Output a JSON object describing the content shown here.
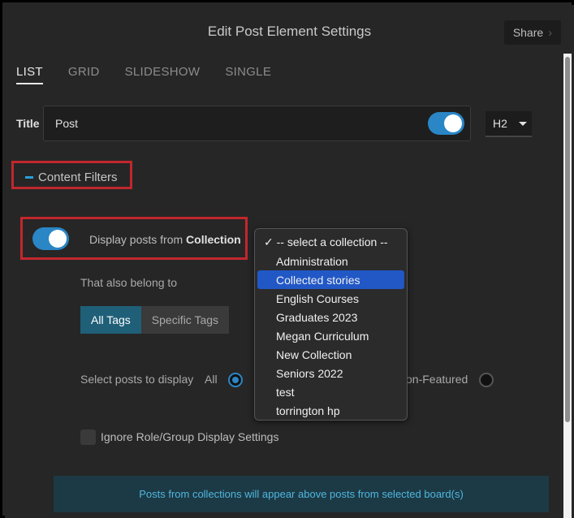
{
  "header": {
    "title": "Edit Post Element Settings",
    "share_label": "Share"
  },
  "tabs": [
    {
      "label": "LIST",
      "active": true
    },
    {
      "label": "GRID",
      "active": false
    },
    {
      "label": "SLIDESHOW",
      "active": false
    },
    {
      "label": "SINGLE",
      "active": false
    }
  ],
  "title_row": {
    "label": "Title",
    "value": "Post",
    "toggle_on": true,
    "heading_level": "H2"
  },
  "content_filters": {
    "label": "Content Filters"
  },
  "collection_row": {
    "label_prefix": "Display posts from ",
    "label_bold": "Collection",
    "toggle_on": true
  },
  "belong_label": "That also belong to",
  "tag_buttons": {
    "all": "All Tags",
    "specific": "Specific Tags"
  },
  "select_posts": {
    "label": "Select posts to display",
    "all_label": "All",
    "nonfeatured_label": "on-Featured"
  },
  "ignore_label": "Ignore Role/Group Display Settings",
  "info_text": "Posts from collections will appear above posts from selected board(s)",
  "dropdown": {
    "items": [
      "✓ -- select a collection --",
      "Administration",
      "Collected stories",
      "English Courses",
      "Graduates 2023",
      "Megan Curriculum",
      "New Collection",
      "Seniors 2022",
      "test",
      "torrington hp"
    ],
    "highlighted": "Collected stories"
  },
  "colors": {
    "accent": "#2a86c5",
    "highlight_box": "#c1272d",
    "info_text": "#4fb6e0",
    "dropdown_highlight": "#2158c6"
  }
}
